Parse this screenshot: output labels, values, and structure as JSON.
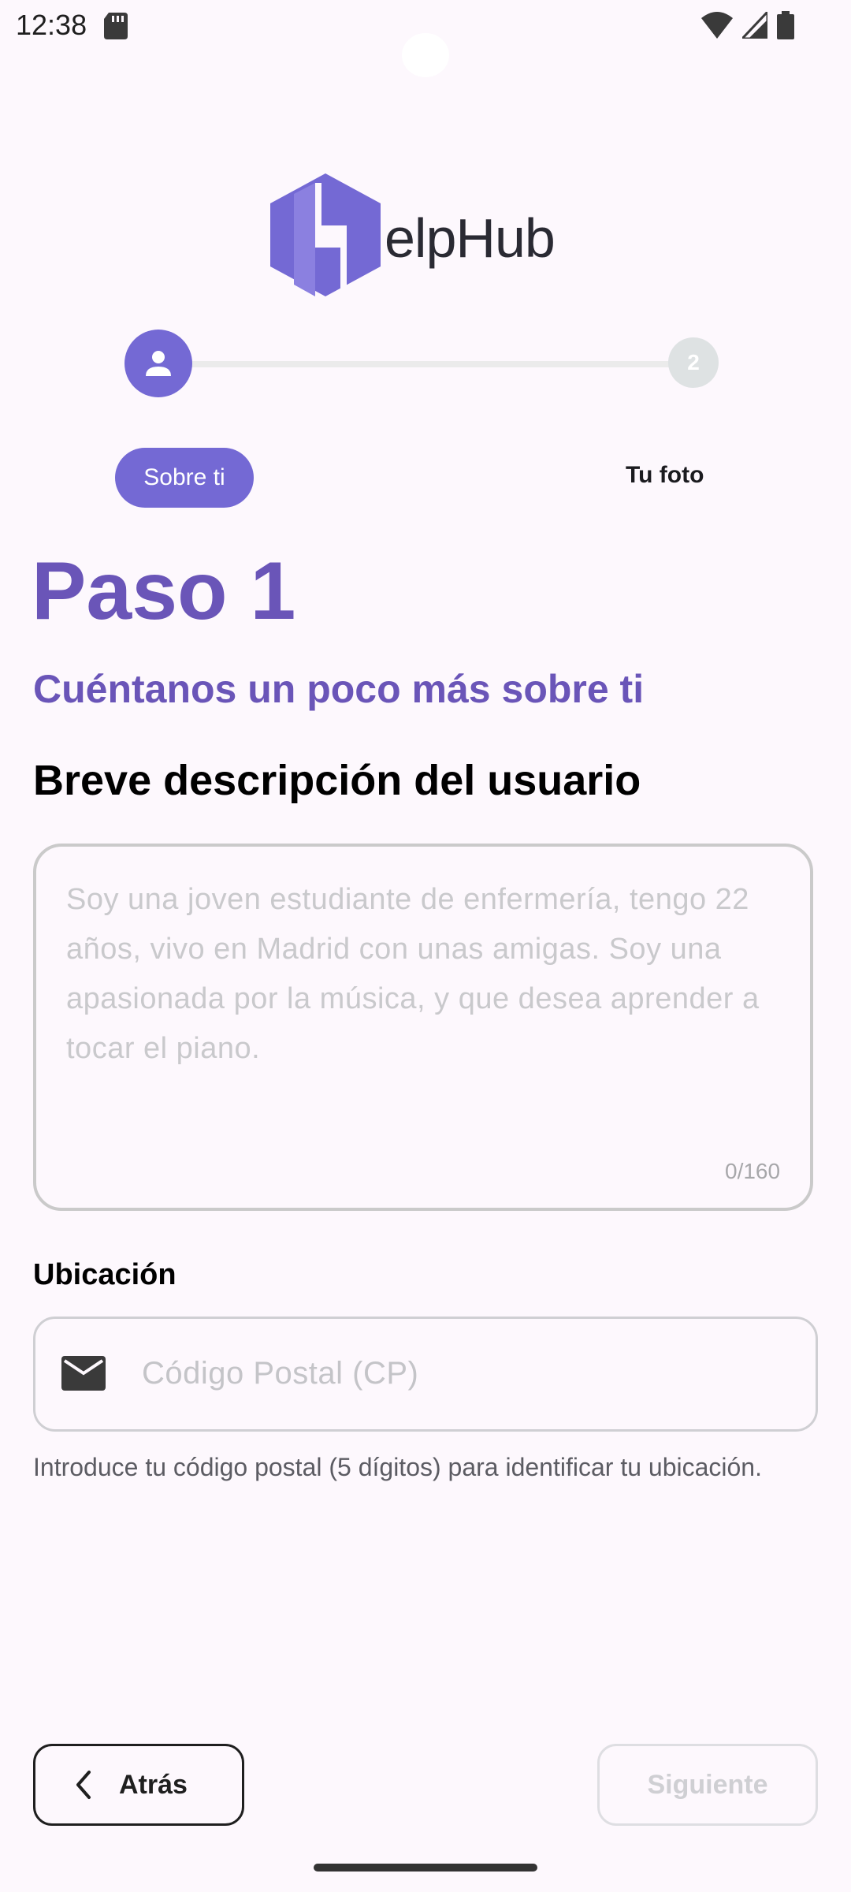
{
  "status_bar": {
    "time": "12:38",
    "icons": [
      "sd-card-icon",
      "wifi-icon",
      "signal-icon",
      "battery-icon"
    ]
  },
  "logo": {
    "text": "elpHub",
    "colors": {
      "mark": "#7469d4",
      "text": "#2a2a33"
    }
  },
  "stepper": {
    "steps": [
      {
        "label": "Sobre ti",
        "icon": "person-icon",
        "active": true
      },
      {
        "label": "Tu foto",
        "number": "2",
        "active": false
      }
    ],
    "active_color": "#7469d4",
    "inactive_color": "#dee2e3"
  },
  "main": {
    "step_title": "Paso 1",
    "subtitle": "Cuéntanos un poco más sobre ti",
    "section_title": "Breve descripción del usuario",
    "description": {
      "value": "",
      "placeholder": "Soy una joven estudiante de enfermería, tengo 22 años, vivo en Madrid con unas amigas. Soy una apasionada por la música, y que desea aprender a tocar el piano.",
      "counter": "0/160"
    },
    "location": {
      "label": "Ubicación",
      "icon": "mail-icon",
      "value": "",
      "placeholder": "Código Postal (CP)",
      "helper": "Introduce tu código postal (5 dígitos) para identificar tu ubicación."
    }
  },
  "footer": {
    "back_label": "Atrás",
    "back_icon": "chevron-left-icon",
    "next_label": "Siguiente"
  },
  "colors": {
    "accent": "#6a55b8",
    "background": "#fdf8fd"
  }
}
